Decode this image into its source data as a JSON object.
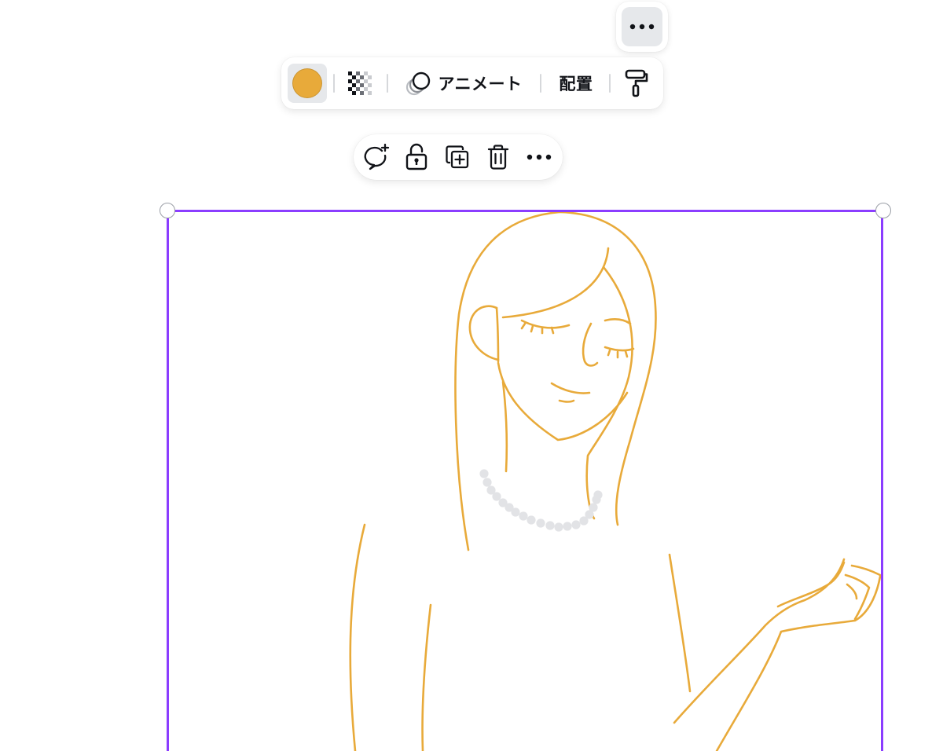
{
  "colors": {
    "accent": "#8b3dff",
    "element_fill": "#E8AA3A",
    "pearls": "#e2e3e6"
  },
  "top_more": {
    "icon": "more-horizontal-icon"
  },
  "toolbar": {
    "color_icon": "color-swatch-icon",
    "transparency_icon": "transparency-checker-icon",
    "animate_icon": "animate-circles-icon",
    "animate_label": "アニメート",
    "position_label": "配置",
    "paint_icon": "paint-roller-icon"
  },
  "element_actions": {
    "comment_icon": "add-comment-icon",
    "lock_icon": "unlock-icon",
    "duplicate_icon": "duplicate-icon",
    "delete_icon": "trash-icon",
    "more_icon": "more-horizontal-icon"
  }
}
